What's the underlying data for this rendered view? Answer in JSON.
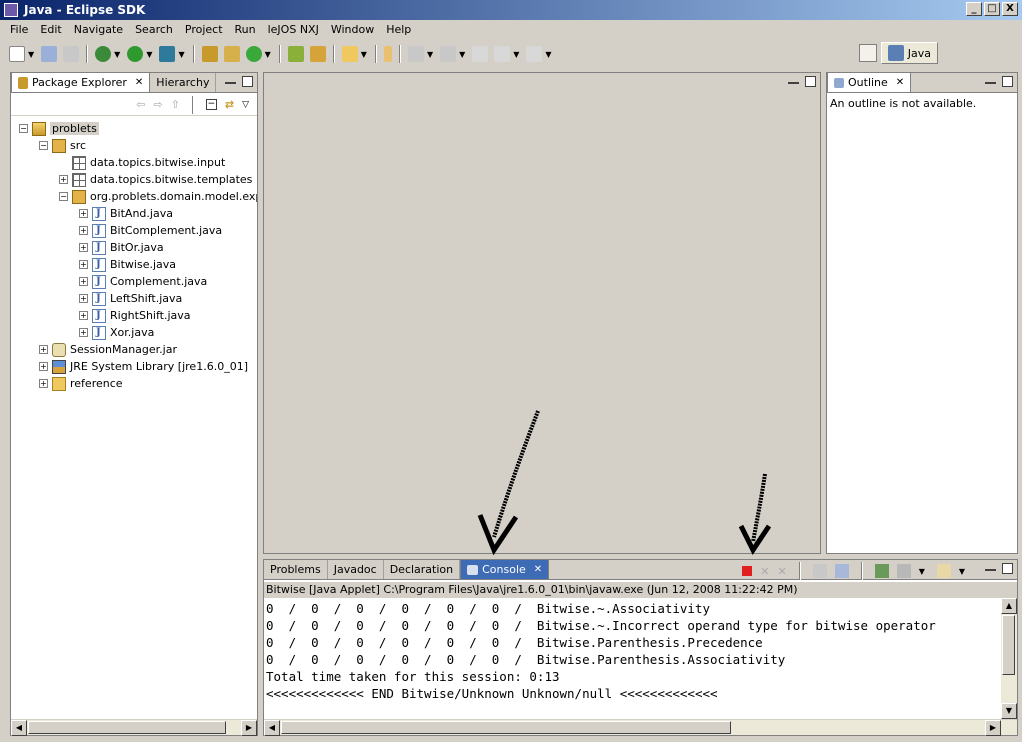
{
  "window": {
    "title": "Java - Eclipse SDK",
    "minimize": "_",
    "maximize": "□",
    "close": "X"
  },
  "menu": [
    "File",
    "Edit",
    "Navigate",
    "Search",
    "Project",
    "Run",
    "leJOS NXJ",
    "Window",
    "Help"
  ],
  "perspective": {
    "label": "Java"
  },
  "explorer": {
    "tabs": [
      {
        "label": "Package Explorer"
      },
      {
        "label": "Hierarchy"
      }
    ],
    "tree": [
      {
        "label": "problets",
        "icon": "project-icon",
        "depth": 0,
        "expander": "−"
      },
      {
        "label": "src",
        "icon": "source-folder-icon",
        "depth": 1,
        "expander": "−"
      },
      {
        "label": "data.topics.bitwise.input",
        "icon": "package-icon",
        "depth": 2,
        "expander": ""
      },
      {
        "label": "data.topics.bitwise.templates",
        "icon": "package-icon",
        "depth": 2,
        "expander": "+"
      },
      {
        "label": "org.problets.domain.model.expres",
        "icon": "package-open-icon",
        "depth": 2,
        "expander": "−"
      },
      {
        "label": "BitAnd.java",
        "icon": "java-file-icon",
        "depth": 3,
        "expander": "+"
      },
      {
        "label": "BitComplement.java",
        "icon": "java-file-icon",
        "depth": 3,
        "expander": "+"
      },
      {
        "label": "BitOr.java",
        "icon": "java-file-icon",
        "depth": 3,
        "expander": "+"
      },
      {
        "label": "Bitwise.java",
        "icon": "java-file-icon",
        "depth": 3,
        "expander": "+"
      },
      {
        "label": "Complement.java",
        "icon": "java-file-icon",
        "depth": 3,
        "expander": "+"
      },
      {
        "label": "LeftShift.java",
        "icon": "java-file-icon",
        "depth": 3,
        "expander": "+"
      },
      {
        "label": "RightShift.java",
        "icon": "java-file-icon",
        "depth": 3,
        "expander": "+"
      },
      {
        "label": "Xor.java",
        "icon": "java-file-icon",
        "depth": 3,
        "expander": "+"
      },
      {
        "label": "SessionManager.jar",
        "icon": "jar-icon",
        "depth": 1,
        "expander": "+"
      },
      {
        "label": "JRE System Library [jre1.6.0_01]",
        "icon": "library-icon",
        "depth": 1,
        "expander": "+"
      },
      {
        "label": "reference",
        "icon": "folder-icon",
        "depth": 1,
        "expander": "+"
      }
    ]
  },
  "outline": {
    "tab_label": "Outline",
    "message": "An outline is not available."
  },
  "bottom": {
    "tabs": [
      {
        "label": "Problems"
      },
      {
        "label": "Javadoc"
      },
      {
        "label": "Declaration"
      },
      {
        "label": "Console"
      }
    ],
    "console_label": "Bitwise [Java Applet] C:\\Program Files\\Java\\jre1.6.0_01\\bin\\javaw.exe (Jun 12, 2008 11:22:42 PM)",
    "lines": [
      "0  /  0  /  0  /  0  /  0  /  0  /  Bitwise.~.Associativity",
      "0  /  0  /  0  /  0  /  0  /  0  /  Bitwise.~.Incorrect operand type for bitwise operator",
      "0  /  0  /  0  /  0  /  0  /  0  /  Bitwise.Parenthesis.Precedence",
      "0  /  0  /  0  /  0  /  0  /  0  /  Bitwise.Parenthesis.Associativity",
      "Total time taken for this session: 0:13",
      "<<<<<<<<<<<<< END Bitwise/Unknown Unknown/null <<<<<<<<<<<<<"
    ]
  },
  "colors": {
    "accent": "#3d6bb5",
    "terminate": "#e02020"
  }
}
